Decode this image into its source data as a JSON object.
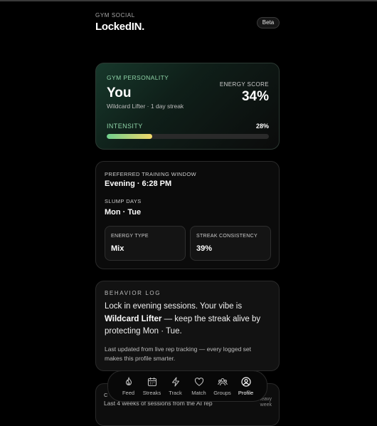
{
  "header": {
    "kicker": "GYM SOCIAL",
    "brand": "LockedIN.",
    "beta": "Beta"
  },
  "personality": {
    "label": "GYM PERSONALITY",
    "name": "You",
    "subtitle": "Wildcard Lifter · 1 day streak",
    "energy_label": "ENERGY SCORE",
    "energy_value": "34%",
    "intensity_label": "INTENSITY",
    "intensity_value": "28%",
    "intensity_fraction": 0.28
  },
  "training": {
    "window_label": "PREFERRED TRAINING WINDOW",
    "window_value": "Evening · 6:28 PM",
    "slump_label": "SLUMP DAYS",
    "slump_value": "Mon · Tue",
    "energy_type_label": "ENERGY TYPE",
    "energy_type_value": "Mix",
    "consistency_label": "STREAK CONSISTENCY",
    "consistency_value": "39%"
  },
  "behavior": {
    "label": "BEHAVIOR LOG",
    "text_1": "Lock in evening sessions. Your vibe is",
    "text_bold": "Wildcard Lifter",
    "text_2": " — keep the streak alive by",
    "text_3": "protecting Mon · Tue.",
    "footer": "Last updated from live rep tracking — every logged set makes this profile smarter."
  },
  "peek": {
    "label": "C",
    "text": "Last 4 weeks of sessions from the AI rep",
    "right": "Dark = heavy week"
  },
  "nav": {
    "items": [
      {
        "label": "Feed",
        "icon": "flame-icon"
      },
      {
        "label": "Streaks",
        "icon": "calendar-icon"
      },
      {
        "label": "Track",
        "icon": "bolt-icon"
      },
      {
        "label": "Match",
        "icon": "heart-icon"
      },
      {
        "label": "Groups",
        "icon": "groups-icon"
      },
      {
        "label": "Profile",
        "icon": "profile-icon"
      }
    ],
    "active": "Profile"
  },
  "colors": {
    "accent_green": "#8fd4a8",
    "bar_start": "#6fd08e",
    "bar_end": "#f2d86a",
    "background": "#000000"
  }
}
